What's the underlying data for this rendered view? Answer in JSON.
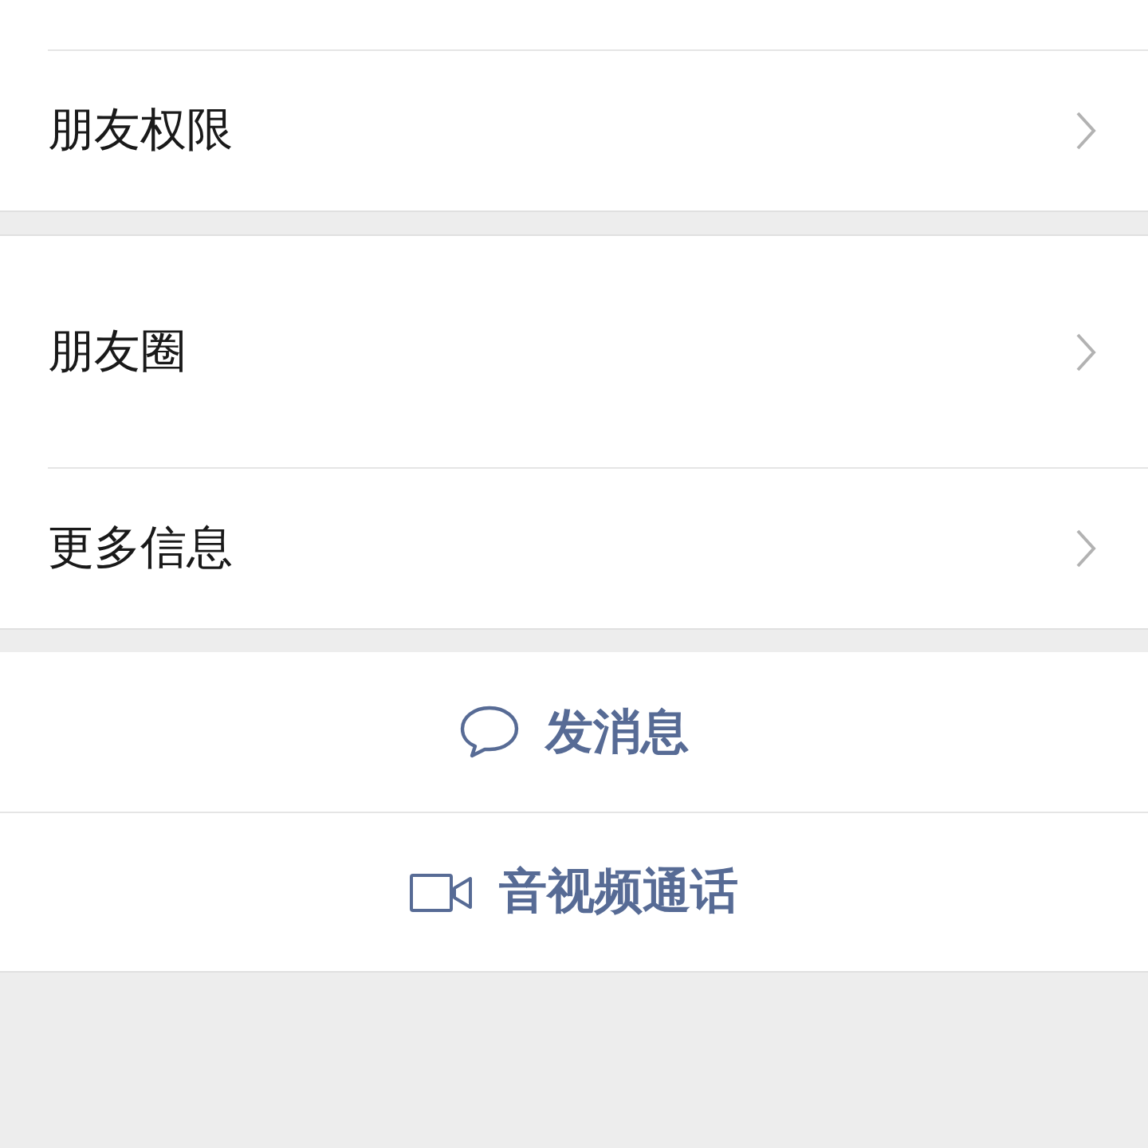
{
  "sections": [
    {
      "rows": [
        {
          "label": "朋友权限",
          "kind": "short"
        }
      ]
    },
    {
      "rows": [
        {
          "label": "朋友圈",
          "kind": "tall"
        },
        {
          "label": "更多信息",
          "kind": "short"
        }
      ]
    }
  ],
  "actions": [
    {
      "label": "发消息",
      "kind": "message"
    },
    {
      "label": "音视频通话",
      "kind": "video"
    }
  ]
}
